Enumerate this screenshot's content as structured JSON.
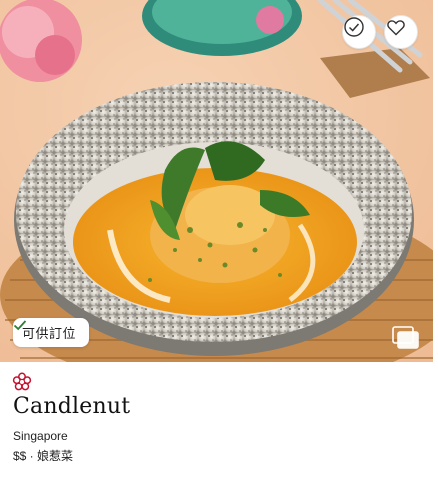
{
  "badge": {
    "label": "可供訂位",
    "icon": "check-icon"
  },
  "actions": {
    "visited_icon": "check-circle-icon",
    "favorite_icon": "heart-icon"
  },
  "gallery": {
    "icon": "gallery-icon"
  },
  "restaurant": {
    "award_icon": "michelin-star-icon",
    "name": "Candlenut",
    "location": "Singapore",
    "meta": "$$ · 娘惹菜"
  },
  "colors": {
    "accent": "#c4122f",
    "badge_check": "#2e7d32"
  }
}
